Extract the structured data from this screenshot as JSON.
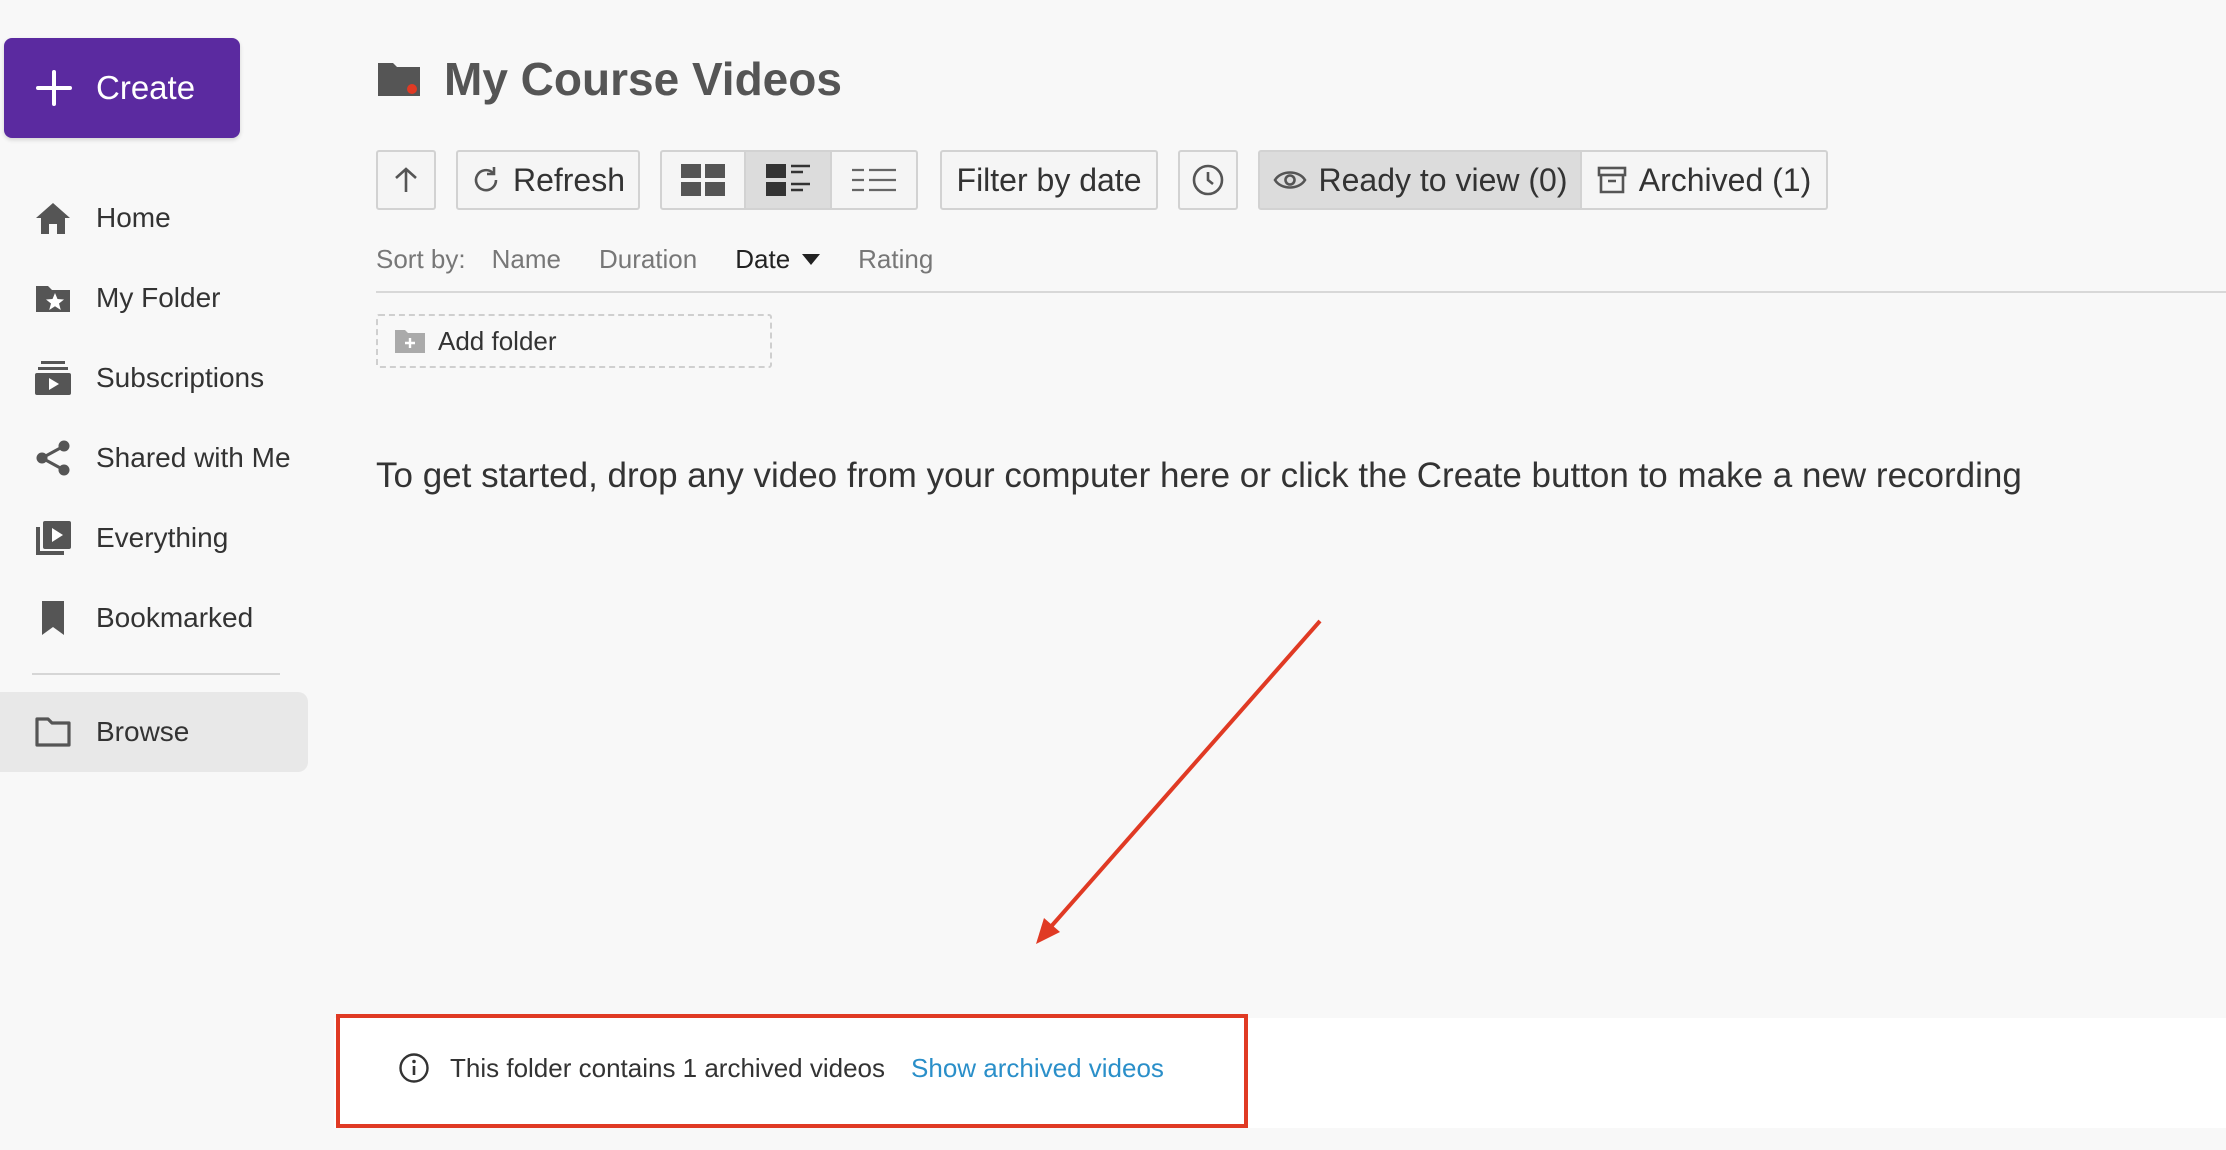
{
  "sidebar": {
    "create_label": "Create",
    "items": [
      {
        "label": "Home",
        "icon": "home-icon"
      },
      {
        "label": "My Folder",
        "icon": "star-folder-icon"
      },
      {
        "label": "Subscriptions",
        "icon": "subscriptions-icon"
      },
      {
        "label": "Shared with Me",
        "icon": "share-icon"
      },
      {
        "label": "Everything",
        "icon": "video-library-icon"
      },
      {
        "label": "Bookmarked",
        "icon": "bookmark-icon"
      }
    ],
    "browse_label": "Browse"
  },
  "main": {
    "title": "My Course Videos",
    "toolbar": {
      "refresh_label": "Refresh",
      "filter_label": "Filter by date",
      "ready_label": "Ready to view (0)",
      "archived_label": "Archived (1)"
    },
    "sort": {
      "label": "Sort by:",
      "options": [
        "Name",
        "Duration",
        "Date",
        "Rating"
      ],
      "selected": "Date"
    },
    "add_folder_label": "Add folder",
    "empty_message": "To get started, drop any video from your computer here or click the Create button to make a new recording",
    "archived_notice": {
      "text": "This folder contains 1 archived videos",
      "link": "Show archived videos"
    }
  },
  "colors": {
    "create_bg": "#5b2aa0",
    "highlight": "#e03a24",
    "link": "#2a8fc9"
  }
}
